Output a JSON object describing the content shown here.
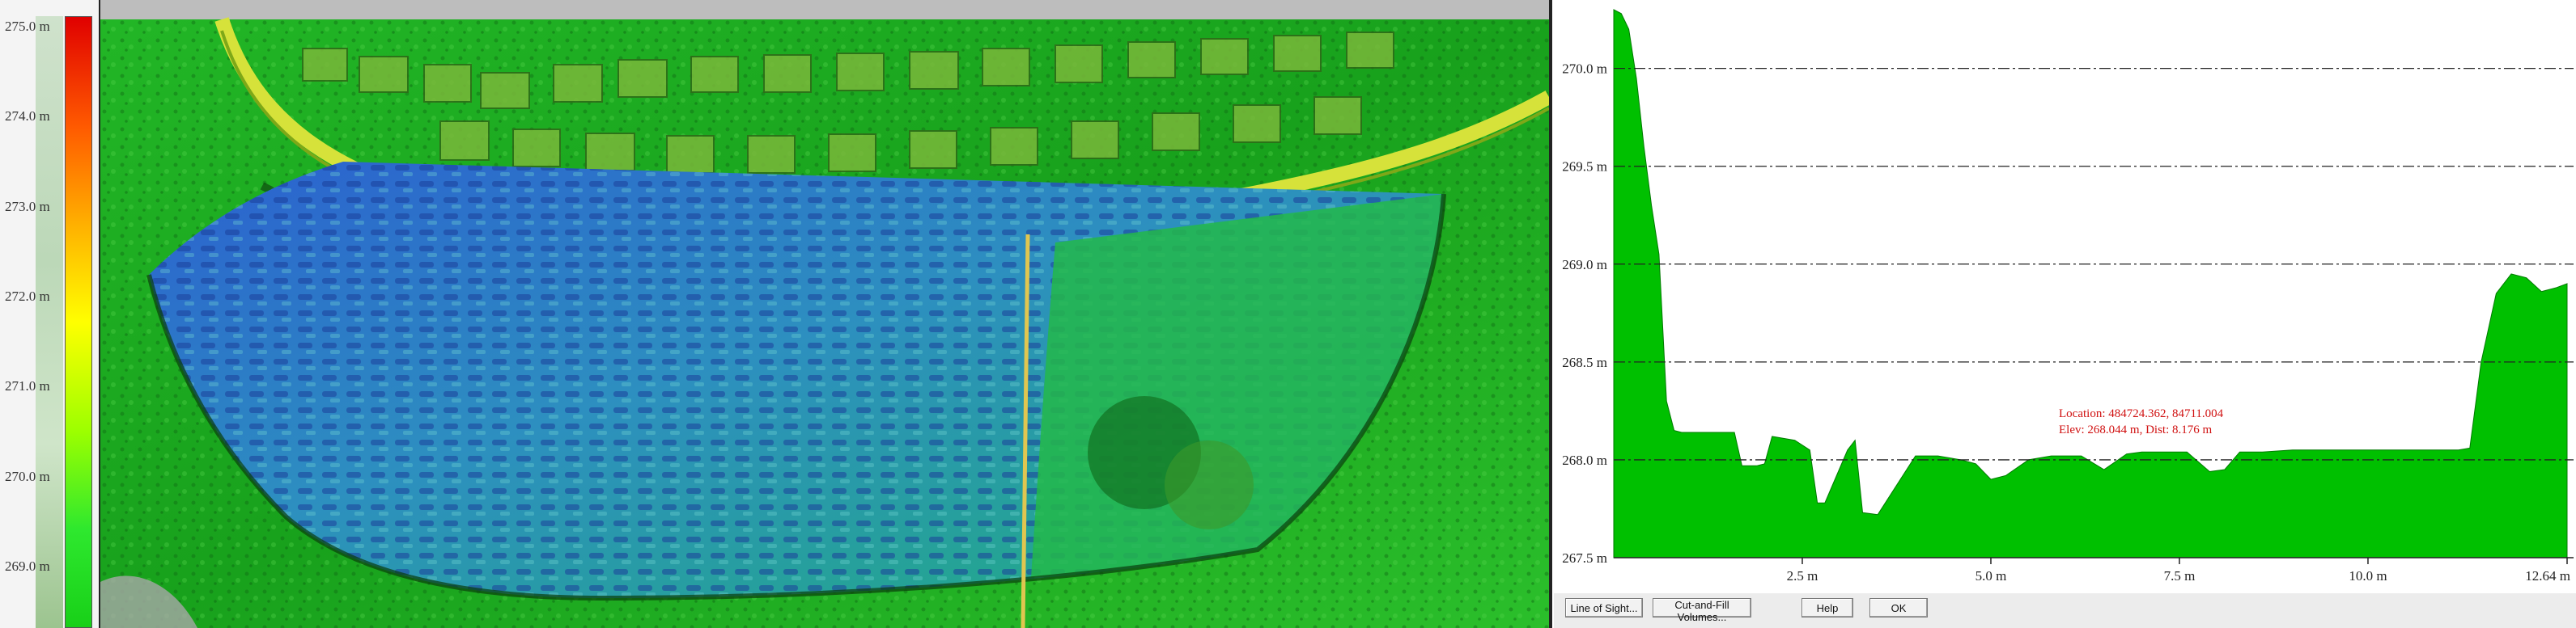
{
  "legend": {
    "ticks": [
      {
        "label": "275.0 m",
        "value": 275.0
      },
      {
        "label": "274.0 m",
        "value": 274.0
      },
      {
        "label": "273.0 m",
        "value": 273.0
      },
      {
        "label": "272.0 m",
        "value": 272.0
      },
      {
        "label": "271.0 m",
        "value": 271.0
      },
      {
        "label": "270.0 m",
        "value": 270.0
      },
      {
        "label": "269.0 m",
        "value": 269.0
      }
    ]
  },
  "chart_data": {
    "type": "area",
    "color": "#00c000",
    "ylim": [
      267.5,
      270.3
    ],
    "xlim": [
      0,
      12.64
    ],
    "yticks": [
      {
        "label": "267.5 m",
        "value": 267.5
      },
      {
        "label": "268.0 m",
        "value": 268.0
      },
      {
        "label": "268.5 m",
        "value": 268.5
      },
      {
        "label": "269.0 m",
        "value": 269.0
      },
      {
        "label": "269.5 m",
        "value": 269.5
      },
      {
        "label": "270.0 m",
        "value": 270.0
      }
    ],
    "xticks": [
      {
        "label": "2.5 m",
        "value": 2.5
      },
      {
        "label": "5.0 m",
        "value": 5.0
      },
      {
        "label": "7.5 m",
        "value": 7.5
      },
      {
        "label": "10.0 m",
        "value": 10.0
      },
      {
        "label": "12.64 m",
        "value": 12.64
      }
    ],
    "x": [
      0,
      0.1,
      0.2,
      0.3,
      0.4,
      0.5,
      0.6,
      0.7,
      0.8,
      0.9,
      1.0,
      1.3,
      1.6,
      1.7,
      1.9,
      2.0,
      2.1,
      2.4,
      2.6,
      2.7,
      2.8,
      3.1,
      3.2,
      3.3,
      3.5,
      4.0,
      4.3,
      4.6,
      4.8,
      5.0,
      5.2,
      5.5,
      5.8,
      6.2,
      6.5,
      6.8,
      7.0,
      7.3,
      7.6,
      7.9,
      8.1,
      8.3,
      8.6,
      9.0,
      9.5,
      10.0,
      10.5,
      11.0,
      11.2,
      11.35,
      11.5,
      11.7,
      11.9,
      12.1,
      12.3,
      12.5,
      12.64
    ],
    "y": [
      270.3,
      270.28,
      270.2,
      269.95,
      269.6,
      269.3,
      269.05,
      268.3,
      268.15,
      268.14,
      268.14,
      268.14,
      268.14,
      267.97,
      267.97,
      267.98,
      268.12,
      268.1,
      268.05,
      267.78,
      267.78,
      268.05,
      268.1,
      267.73,
      267.72,
      268.02,
      268.02,
      268.0,
      267.98,
      267.9,
      267.92,
      268.0,
      268.02,
      268.02,
      267.95,
      268.03,
      268.04,
      268.04,
      268.04,
      267.94,
      267.95,
      268.04,
      268.04,
      268.05,
      268.05,
      268.05,
      268.05,
      268.05,
      268.05,
      268.06,
      268.5,
      268.85,
      268.95,
      268.93,
      268.86,
      268.88,
      268.9
    ],
    "annotation": {
      "line1": "Location: 484724.362, 84711.004",
      "line2": "Elev: 268.044 m, Dist: 8.176 m"
    }
  },
  "buttons": {
    "line_of_sight": "Line of Sight...",
    "cut_fill": "Cut-and-Fill Volumes...",
    "help": "Help",
    "ok": "OK"
  }
}
